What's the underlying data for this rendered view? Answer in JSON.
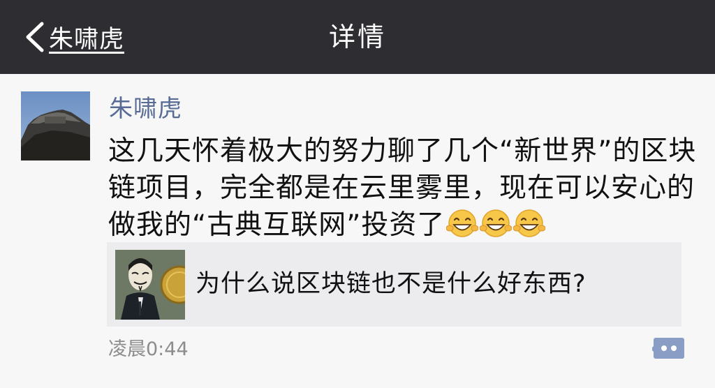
{
  "navbar": {
    "back_label": "朱啸虎",
    "title": "详情",
    "back_icon": "chevron-left-icon"
  },
  "post": {
    "author": "朱啸虎",
    "avatar_icon": "avatar-photo",
    "text_lines": [
      "这几天怀着极大的努力聊了几个“新世界”的区块",
      "链项目，完全都是在云里雾里，现在可以安心的",
      "做我的“古典互联网”投资了"
    ],
    "emoji_icon": "grinning-face-emoji",
    "emoji_count": 3,
    "shared_link": {
      "thumbnail_icon": "masked-figure-bitcoin-thumbnail",
      "title": "为什么说区块链也不是什么好东西?"
    },
    "timestamp": "凌晨0:44",
    "comment_icon": "comment-icon"
  },
  "colors": {
    "navbar_bg": "#2e2d32",
    "page_bg": "#f7f7f7",
    "author_name": "#576b95",
    "share_card_bg": "#ececef",
    "timestamp": "#8c8c8c",
    "comment_icon": "#8a9dc4"
  }
}
